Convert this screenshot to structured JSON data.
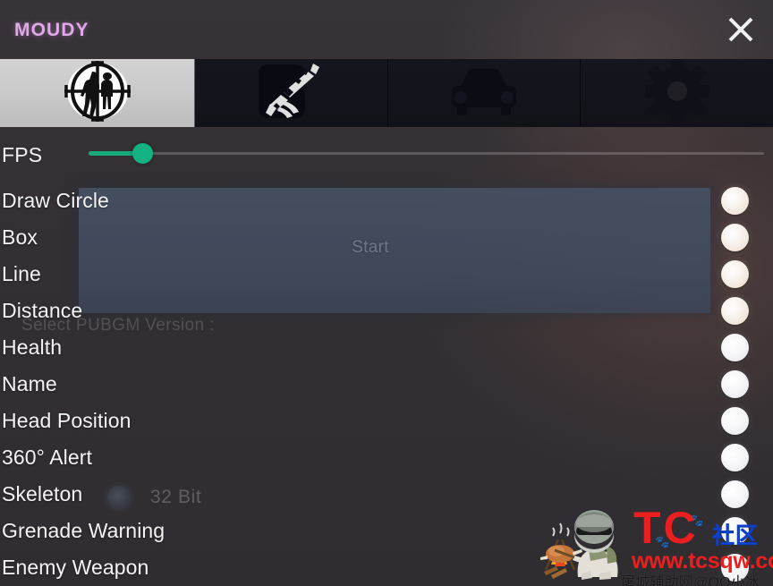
{
  "window": {
    "brand": "MOUDY",
    "close_label": "×",
    "close_icon": "close-icon"
  },
  "tabs": [
    {
      "id": "esp",
      "icon": "crosshair-targets-icon",
      "label": "",
      "active": true
    },
    {
      "id": "weapon",
      "icon": "rifle-icon",
      "label": "",
      "active": false
    },
    {
      "id": "vehicle",
      "icon": "car-icon",
      "label": "",
      "active": false
    },
    {
      "id": "settings",
      "icon": "gear-icon",
      "label": "",
      "active": false
    }
  ],
  "slider": {
    "label": "FPS",
    "value_percent": 8,
    "fill_color": "#18a97b",
    "thumb_color": "#13b283",
    "track_color": "#a09ca0"
  },
  "options": [
    {
      "label": "Draw Circle",
      "enabled": false,
      "tone": "warm"
    },
    {
      "label": "Box",
      "enabled": false,
      "tone": "warm"
    },
    {
      "label": "Line",
      "enabled": false,
      "tone": "warm"
    },
    {
      "label": "Distance",
      "enabled": false,
      "tone": "warm"
    },
    {
      "label": "Health",
      "enabled": false,
      "tone": "cool"
    },
    {
      "label": "Name",
      "enabled": false,
      "tone": "cool"
    },
    {
      "label": "Head Position",
      "enabled": false,
      "tone": "cool"
    },
    {
      "label": "360° Alert",
      "enabled": false,
      "tone": "cool"
    },
    {
      "label": "Skeleton",
      "enabled": false,
      "tone": "cool"
    },
    {
      "label": "Grenade Warning",
      "enabled": false,
      "tone": "cool"
    },
    {
      "label": "Enemy Weapon",
      "enabled": false,
      "tone": "cool"
    }
  ],
  "background_window": {
    "start_button": "Start",
    "version_prompt": "Select PUBGM Version :",
    "bit_option": "32 Bit",
    "panel_color": "#455062"
  },
  "watermark": {
    "logo": "TC",
    "community": "社区",
    "url": "www.tcsqw.com",
    "subtitle": "屠城辅助网@QQ小冰",
    "logo_color": "#ea1f1f",
    "community_color": "#1450e8"
  }
}
